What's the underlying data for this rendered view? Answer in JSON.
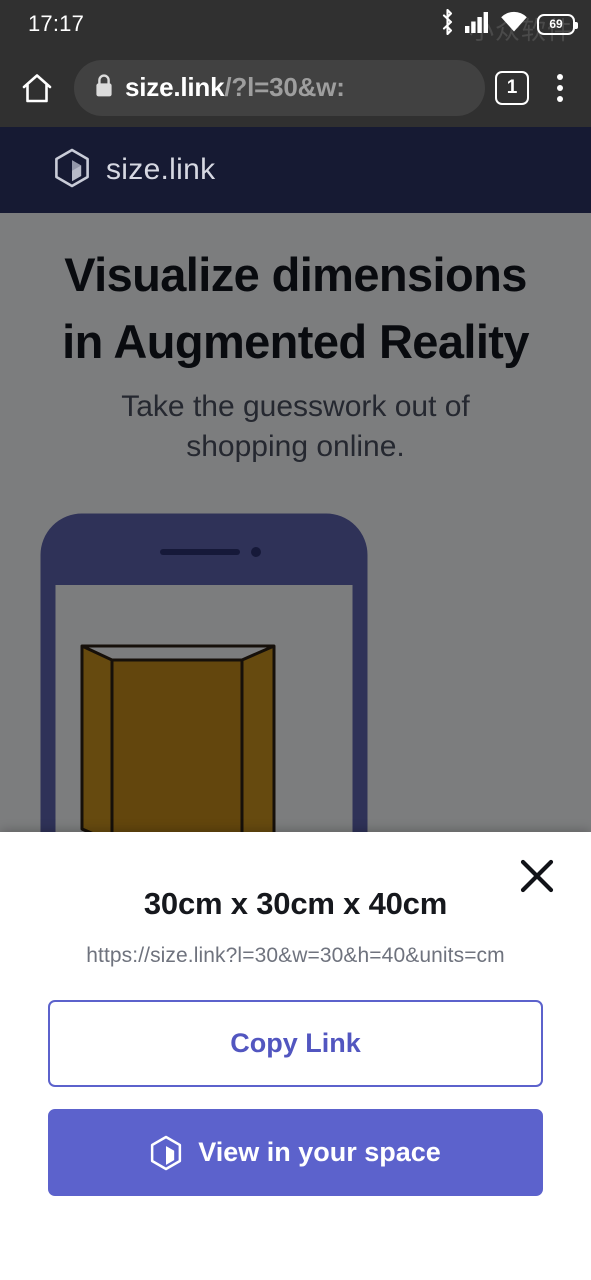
{
  "status_bar": {
    "time": "17:17",
    "battery_level": "69",
    "watermark": "小众软件",
    "icons": [
      "bluetooth-icon",
      "cellular-signal-icon",
      "wifi-icon",
      "battery-icon"
    ]
  },
  "browser": {
    "home_icon": "home-icon",
    "lock_icon": "lock-icon",
    "url_host": "size.link",
    "url_path": "/?l=30&w:",
    "tab_count": "1",
    "menu_icon": "overflow-menu-icon"
  },
  "site_header": {
    "logo_icon": "cube-logo-icon",
    "brand": "size.link"
  },
  "hero": {
    "title_line1": "Visualize dimensions",
    "title_line2": "in Augmented Reality",
    "subtitle": "Take the guesswork out of shopping online."
  },
  "illustration": {
    "name": "phone-ar-illustration",
    "phone_frame_color": "#5d63ad",
    "box_color": "#c8911f",
    "box_edge_color": "#2b2114"
  },
  "sheet": {
    "close_icon": "close-icon",
    "dimensions_title": "30cm x 30cm x 40cm",
    "share_url": "https://size.link?l=30&w=30&h=40&units=cm",
    "copy_label": "Copy Link",
    "view_label": "View in your space",
    "view_icon": "cube-logo-icon"
  },
  "colors": {
    "status_bar": "#303030",
    "site_header": "#161a33",
    "accent": "#5c62cc",
    "page_bg": "#f4f5f8",
    "dim_overlay": "rgba(0,0,0,0.49)"
  }
}
